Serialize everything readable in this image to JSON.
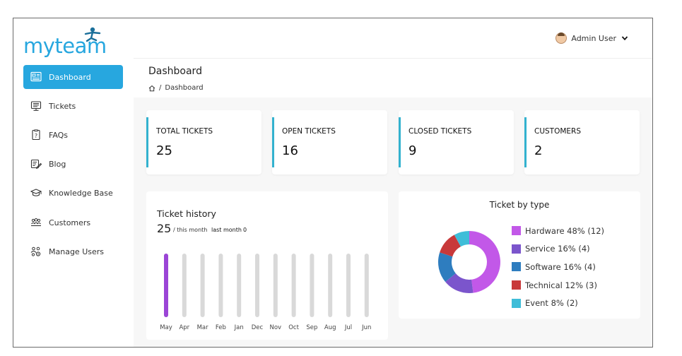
{
  "brand": {
    "name": "myteam"
  },
  "header": {
    "user_name": "Admin User"
  },
  "sidebar": {
    "items": [
      {
        "label": "Dashboard"
      },
      {
        "label": "Tickets"
      },
      {
        "label": "FAQs"
      },
      {
        "label": "Blog"
      },
      {
        "label": "Knowledge Base"
      },
      {
        "label": "Customers"
      },
      {
        "label": "Manage Users"
      }
    ]
  },
  "page": {
    "title": "Dashboard",
    "breadcrumb": {
      "separator": "/",
      "current": "Dashboard"
    }
  },
  "stats": [
    {
      "label": "TOTAL TICKETS",
      "value": "25"
    },
    {
      "label": "OPEN TICKETS",
      "value": "16"
    },
    {
      "label": "CLOSED TICKETS",
      "value": "9"
    },
    {
      "label": "CUSTOMERS",
      "value": "2"
    }
  ],
  "colors": {
    "accent": "#27a7df",
    "stat_bar": "#33b2cf",
    "history_active": "#9b45d6",
    "history_bar": "#d9d9d9"
  },
  "ticket_history": {
    "title": "Ticket history",
    "this_month_value": "25",
    "this_month_label": "/ this month",
    "last_month_label": "last month",
    "last_month_value": "0"
  },
  "ticket_types": {
    "title": "Ticket by type"
  },
  "chart_data": [
    {
      "type": "bar",
      "title": "Ticket history",
      "categories": [
        "May",
        "Apr",
        "Mar",
        "Feb",
        "Jan",
        "Dec",
        "Nov",
        "Oct",
        "Sep",
        "Aug",
        "Jul",
        "Jun"
      ],
      "values": [
        25,
        0,
        0,
        0,
        0,
        0,
        0,
        0,
        0,
        0,
        0,
        0
      ],
      "highlight_index": 0,
      "grid": false
    },
    {
      "type": "pie",
      "title": "Ticket by type",
      "donut": true,
      "legend_position": "right",
      "slices": [
        {
          "label": "Hardware 48% (12)",
          "value": 12,
          "color": "#c258e8"
        },
        {
          "label": "Service 16% (4)",
          "value": 4,
          "color": "#7b55cc"
        },
        {
          "label": "Software 16% (4)",
          "value": 4,
          "color": "#2e7dbf"
        },
        {
          "label": "Technical 12% (3)",
          "value": 3,
          "color": "#c8393a"
        },
        {
          "label": "Event 8% (2)",
          "value": 2,
          "color": "#3fbdd8"
        }
      ]
    }
  ]
}
